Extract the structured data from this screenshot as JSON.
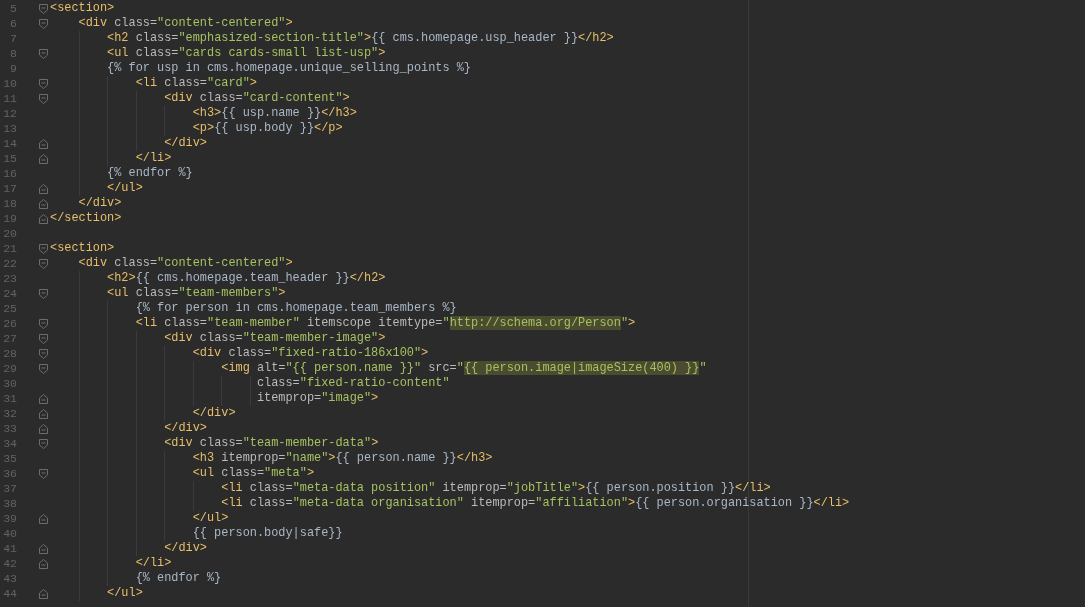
{
  "editor": {
    "lines": [
      {
        "number": "5",
        "fold_start": true,
        "fold_end": false,
        "tokens": [
          {
            "kind": "tag",
            "text": "<section>"
          }
        ]
      },
      {
        "number": "6",
        "fold_start": true,
        "fold_end": false,
        "tokens": [
          {
            "kind": "tag",
            "text": "    <div"
          },
          {
            "kind": "attr",
            "text": " class="
          },
          {
            "kind": "value",
            "text": "\"content-centered\""
          },
          {
            "kind": "tag",
            "text": ">"
          }
        ]
      },
      {
        "number": "7",
        "fold_start": false,
        "fold_end": false,
        "tokens": [
          {
            "kind": "tag",
            "text": "        <h2"
          },
          {
            "kind": "attr",
            "text": " class="
          },
          {
            "kind": "value",
            "text": "\"emphasized-section-title\""
          },
          {
            "kind": "tag",
            "text": ">"
          },
          {
            "kind": "text",
            "text": "{{ cms.homepage.usp_header }}"
          },
          {
            "kind": "tag",
            "text": "</h2>"
          }
        ]
      },
      {
        "number": "8",
        "fold_start": true,
        "fold_end": false,
        "tokens": [
          {
            "kind": "tag",
            "text": "        <ul"
          },
          {
            "kind": "attr",
            "text": " class="
          },
          {
            "kind": "value",
            "text": "\"cards cards-small list-usp\""
          },
          {
            "kind": "tag",
            "text": ">"
          }
        ]
      },
      {
        "number": "9",
        "fold_start": false,
        "fold_end": false,
        "tokens": [
          {
            "kind": "text",
            "text": "        {% for usp in cms.homepage.unique_selling_points %}"
          }
        ]
      },
      {
        "number": "10",
        "fold_start": true,
        "fold_end": false,
        "tokens": [
          {
            "kind": "tag",
            "text": "            <li"
          },
          {
            "kind": "attr",
            "text": " class="
          },
          {
            "kind": "value",
            "text": "\"card\""
          },
          {
            "kind": "tag",
            "text": ">"
          }
        ]
      },
      {
        "number": "11",
        "fold_start": true,
        "fold_end": false,
        "tokens": [
          {
            "kind": "tag",
            "text": "                <div"
          },
          {
            "kind": "attr",
            "text": " class="
          },
          {
            "kind": "value",
            "text": "\"card-content\""
          },
          {
            "kind": "tag",
            "text": ">"
          }
        ]
      },
      {
        "number": "12",
        "fold_start": false,
        "fold_end": false,
        "tokens": [
          {
            "kind": "tag",
            "text": "                    <h3>"
          },
          {
            "kind": "text",
            "text": "{{ usp.name }}"
          },
          {
            "kind": "tag",
            "text": "</h3>"
          }
        ]
      },
      {
        "number": "13",
        "fold_start": false,
        "fold_end": false,
        "tokens": [
          {
            "kind": "tag",
            "text": "                    <p>"
          },
          {
            "kind": "text",
            "text": "{{ usp.body }}"
          },
          {
            "kind": "tag",
            "text": "</p>"
          }
        ]
      },
      {
        "number": "14",
        "fold_start": false,
        "fold_end": true,
        "tokens": [
          {
            "kind": "tag",
            "text": "                </div>"
          }
        ]
      },
      {
        "number": "15",
        "fold_start": false,
        "fold_end": true,
        "tokens": [
          {
            "kind": "tag",
            "text": "            </li>"
          }
        ]
      },
      {
        "number": "16",
        "fold_start": false,
        "fold_end": false,
        "tokens": [
          {
            "kind": "text",
            "text": "        {% endfor %}"
          }
        ]
      },
      {
        "number": "17",
        "fold_start": false,
        "fold_end": true,
        "tokens": [
          {
            "kind": "tag",
            "text": "        </ul>"
          }
        ]
      },
      {
        "number": "18",
        "fold_start": false,
        "fold_end": true,
        "tokens": [
          {
            "kind": "tag",
            "text": "    </div>"
          }
        ]
      },
      {
        "number": "19",
        "fold_start": false,
        "fold_end": true,
        "tokens": [
          {
            "kind": "tag",
            "text": "</section>"
          }
        ]
      },
      {
        "number": "20",
        "fold_start": false,
        "fold_end": false
      },
      {
        "number": "21",
        "fold_start": true,
        "fold_end": false,
        "tokens": [
          {
            "kind": "tag",
            "text": "<section>"
          }
        ]
      },
      {
        "number": "22",
        "fold_start": true,
        "fold_end": false,
        "tokens": [
          {
            "kind": "tag",
            "text": "    <div"
          },
          {
            "kind": "attr",
            "text": " class="
          },
          {
            "kind": "value",
            "text": "\"content-centered\""
          },
          {
            "kind": "tag",
            "text": ">"
          }
        ]
      },
      {
        "number": "23",
        "fold_start": false,
        "fold_end": false,
        "tokens": [
          {
            "kind": "tag",
            "text": "        <h2>"
          },
          {
            "kind": "text",
            "text": "{{ cms.homepage.team_header }}"
          },
          {
            "kind": "tag",
            "text": "</h2>"
          }
        ]
      },
      {
        "number": "24",
        "fold_start": true,
        "fold_end": false,
        "tokens": [
          {
            "kind": "tag",
            "text": "        <ul"
          },
          {
            "kind": "attr",
            "text": " class="
          },
          {
            "kind": "value",
            "text": "\"team-members\""
          },
          {
            "kind": "tag",
            "text": ">"
          }
        ]
      },
      {
        "number": "25",
        "fold_start": false,
        "fold_end": false,
        "tokens": [
          {
            "kind": "text",
            "text": "            {% for person in cms.homepage.team_members %}"
          }
        ]
      },
      {
        "number": "26",
        "fold_start": true,
        "fold_end": false,
        "tokens": [
          {
            "kind": "tag",
            "text": "            <li"
          },
          {
            "kind": "attr",
            "text": " class="
          },
          {
            "kind": "value",
            "text": "\"team-member\""
          },
          {
            "kind": "attr",
            "text": " itemscope itemtype="
          },
          {
            "kind": "value",
            "text": "\""
          },
          {
            "kind": "highlight",
            "text": "http://schema.org/Person"
          },
          {
            "kind": "value",
            "text": "\""
          },
          {
            "kind": "tag",
            "text": ">"
          }
        ]
      },
      {
        "number": "27",
        "fold_start": true,
        "fold_end": false,
        "tokens": [
          {
            "kind": "tag",
            "text": "                <div"
          },
          {
            "kind": "attr",
            "text": " class="
          },
          {
            "kind": "value",
            "text": "\"team-member-image\""
          },
          {
            "kind": "tag",
            "text": ">"
          }
        ]
      },
      {
        "number": "28",
        "fold_start": true,
        "fold_end": false,
        "tokens": [
          {
            "kind": "tag",
            "text": "                    <div"
          },
          {
            "kind": "attr",
            "text": " class="
          },
          {
            "kind": "value",
            "text": "\"fixed-ratio-186x100\""
          },
          {
            "kind": "tag",
            "text": ">"
          }
        ]
      },
      {
        "number": "29",
        "fold_start": true,
        "fold_end": false,
        "tokens": [
          {
            "kind": "tag",
            "text": "                        <img"
          },
          {
            "kind": "attr",
            "text": " alt="
          },
          {
            "kind": "value",
            "text": "\"{{ person.name }}\""
          },
          {
            "kind": "attr",
            "text": " src="
          },
          {
            "kind": "value",
            "text": "\""
          },
          {
            "kind": "highlight",
            "text": "{{ person.image|imageSize(400) }}"
          },
          {
            "kind": "value",
            "text": "\""
          }
        ]
      },
      {
        "number": "30",
        "fold_start": false,
        "fold_end": false,
        "tokens": [
          {
            "kind": "attr",
            "text": "                             class="
          },
          {
            "kind": "value",
            "text": "\"fixed-ratio-content\""
          }
        ]
      },
      {
        "number": "31",
        "fold_start": false,
        "fold_end": true,
        "tokens": [
          {
            "kind": "attr",
            "text": "                             itemprop="
          },
          {
            "kind": "value",
            "text": "\"image\""
          },
          {
            "kind": "tag",
            "text": ">"
          }
        ]
      },
      {
        "number": "32",
        "fold_start": false,
        "fold_end": true,
        "tokens": [
          {
            "kind": "tag",
            "text": "                    </div>"
          }
        ]
      },
      {
        "number": "33",
        "fold_start": false,
        "fold_end": true,
        "tokens": [
          {
            "kind": "tag",
            "text": "                </div>"
          }
        ]
      },
      {
        "number": "34",
        "fold_start": true,
        "fold_end": false,
        "tokens": [
          {
            "kind": "tag",
            "text": "                <div"
          },
          {
            "kind": "attr",
            "text": " class="
          },
          {
            "kind": "value",
            "text": "\"team-member-data\""
          },
          {
            "kind": "tag",
            "text": ">"
          }
        ]
      },
      {
        "number": "35",
        "fold_start": false,
        "fold_end": false,
        "tokens": [
          {
            "kind": "tag",
            "text": "                    <h3"
          },
          {
            "kind": "attr",
            "text": " itemprop="
          },
          {
            "kind": "value",
            "text": "\"name\""
          },
          {
            "kind": "tag",
            "text": ">"
          },
          {
            "kind": "text",
            "text": "{{ person.name }}"
          },
          {
            "kind": "tag",
            "text": "</h3>"
          }
        ]
      },
      {
        "number": "36",
        "fold_start": true,
        "fold_end": false,
        "tokens": [
          {
            "kind": "tag",
            "text": "                    <ul"
          },
          {
            "kind": "attr",
            "text": " class="
          },
          {
            "kind": "value",
            "text": "\"meta\""
          },
          {
            "kind": "tag",
            "text": ">"
          }
        ]
      },
      {
        "number": "37",
        "fold_start": false,
        "fold_end": false,
        "tokens": [
          {
            "kind": "tag",
            "text": "                        <li"
          },
          {
            "kind": "attr",
            "text": " class="
          },
          {
            "kind": "value",
            "text": "\"meta-data position\""
          },
          {
            "kind": "attr",
            "text": " itemprop="
          },
          {
            "kind": "value",
            "text": "\"jobTitle\""
          },
          {
            "kind": "tag",
            "text": ">"
          },
          {
            "kind": "text",
            "text": "{{ person.position }}"
          },
          {
            "kind": "tag",
            "text": "</li>"
          }
        ]
      },
      {
        "number": "38",
        "fold_start": false,
        "fold_end": false,
        "tokens": [
          {
            "kind": "tag",
            "text": "                        <li"
          },
          {
            "kind": "attr",
            "text": " class="
          },
          {
            "kind": "value",
            "text": "\"meta-data organisation\""
          },
          {
            "kind": "attr",
            "text": " itemprop="
          },
          {
            "kind": "value",
            "text": "\"affiliation\""
          },
          {
            "kind": "tag",
            "text": ">"
          },
          {
            "kind": "text",
            "text": "{{ person.organisation }}"
          },
          {
            "kind": "tag",
            "text": "</li>"
          }
        ]
      },
      {
        "number": "39",
        "fold_start": false,
        "fold_end": true,
        "tokens": [
          {
            "kind": "tag",
            "text": "                    </ul>"
          }
        ]
      },
      {
        "number": "40",
        "fold_start": false,
        "fold_end": false,
        "tokens": [
          {
            "kind": "text",
            "text": "                    {{ person.body|safe}}"
          }
        ]
      },
      {
        "number": "41",
        "fold_start": false,
        "fold_end": true,
        "tokens": [
          {
            "kind": "tag",
            "text": "                </div>"
          }
        ]
      },
      {
        "number": "42",
        "fold_start": false,
        "fold_end": true,
        "tokens": [
          {
            "kind": "tag",
            "text": "            </li>"
          }
        ]
      },
      {
        "number": "43",
        "fold_start": false,
        "fold_end": false,
        "tokens": [
          {
            "kind": "text",
            "text": "            {% endfor %}"
          }
        ]
      },
      {
        "number": "44",
        "fold_start": false,
        "fold_end": true,
        "tokens": [
          {
            "kind": "tag",
            "text": "        </ul>"
          }
        ]
      }
    ]
  }
}
